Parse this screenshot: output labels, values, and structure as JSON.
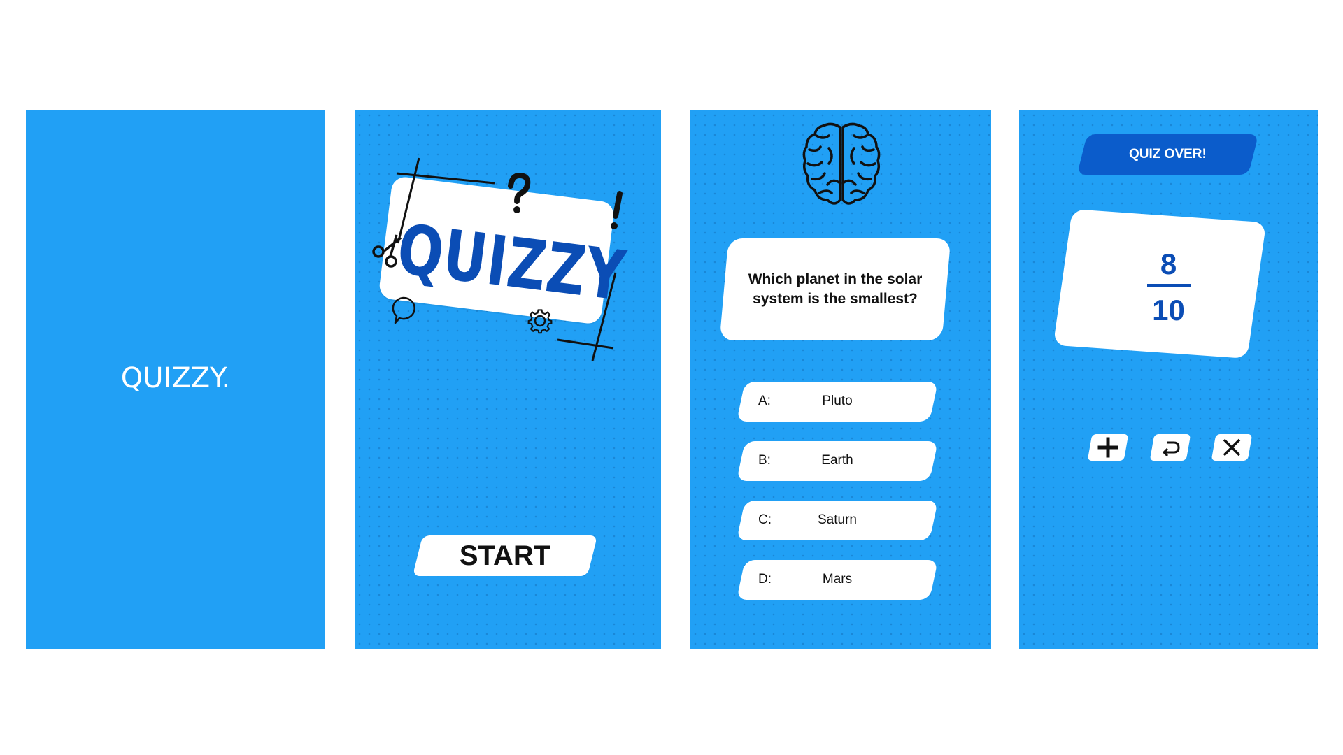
{
  "screens": {
    "splash": {
      "title": "QUIZZY."
    },
    "start": {
      "logo_text": "QUIZZY",
      "start_label": "START",
      "icons": [
        "question-mark-icon",
        "exclamation-icon",
        "scissors-icon",
        "speech-bubble-icon",
        "gear-icon"
      ]
    },
    "question": {
      "icon": "brain-icon",
      "question_text": "Which planet in the solar system is the smallest?",
      "answers": [
        {
          "letter": "A:",
          "text": "Pluto"
        },
        {
          "letter": "B:",
          "text": "Earth"
        },
        {
          "letter": "C:",
          "text": "Saturn"
        },
        {
          "letter": "D:",
          "text": "Mars"
        }
      ]
    },
    "results": {
      "badge": "QUIZ OVER!",
      "score": "8",
      "total": "10",
      "actions": [
        "plus-icon",
        "return-icon",
        "close-icon"
      ]
    }
  },
  "colors": {
    "screen_background": "#21A0F5",
    "accent_dark_blue": "#0B4DB5",
    "badge_blue": "#0B5CCB",
    "card": "#FFFFFF",
    "text": "#111111"
  }
}
